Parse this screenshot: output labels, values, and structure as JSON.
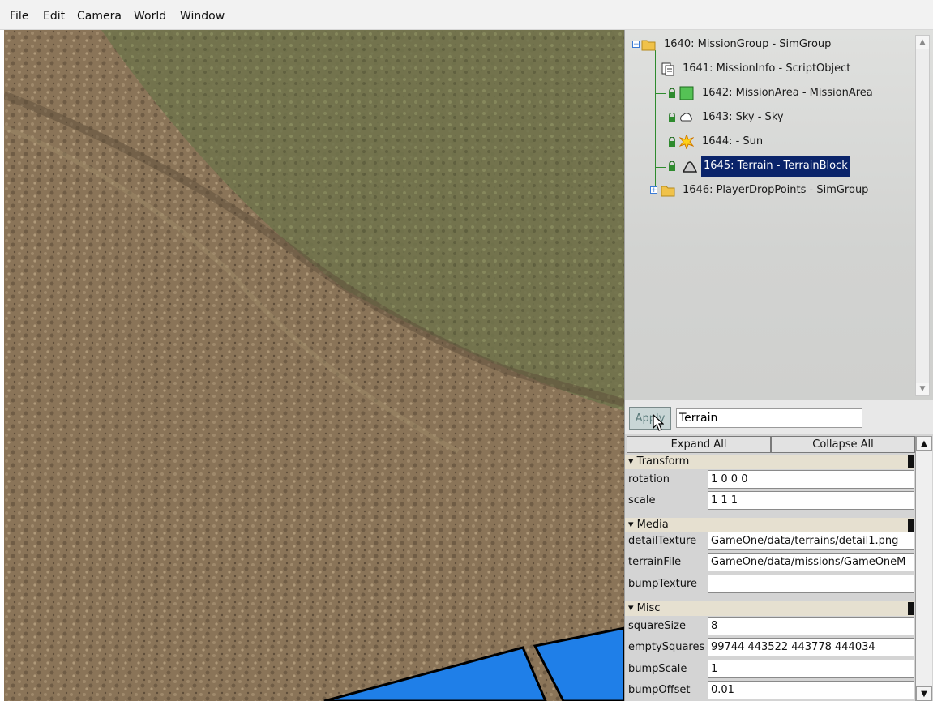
{
  "menu": [
    "File",
    "Edit",
    "Camera",
    "World",
    "Window"
  ],
  "tree": {
    "nodes": [
      {
        "label": "1640: MissionGroup - SimGroup",
        "icon": "folder-icon"
      },
      {
        "label": "1641: MissionInfo - ScriptObject",
        "icon": "script-object-icon"
      },
      {
        "label": "1642: MissionArea - MissionArea",
        "icon": "mission-area-icon"
      },
      {
        "label": "1643: Sky - Sky",
        "icon": "sky-icon"
      },
      {
        "label": "1644: - Sun",
        "icon": "sun-icon"
      },
      {
        "label": "1645: Terrain - TerrainBlock",
        "icon": "terrain-icon",
        "selected": true
      },
      {
        "label": "1646: PlayerDropPoints - SimGroup",
        "icon": "folder-icon"
      }
    ],
    "scroll_up": "▲",
    "scroll_down": "▼"
  },
  "apply": {
    "button": "Apply",
    "name_value": "Terrain"
  },
  "inspector": {
    "expand_all": "Expand All",
    "collapse_all": "Collapse All",
    "sections": [
      {
        "title": "Transform",
        "fields": [
          {
            "label": "rotation",
            "value": "1 0 0 0"
          },
          {
            "label": "scale",
            "value": "1 1 1"
          }
        ]
      },
      {
        "title": "Media",
        "fields": [
          {
            "label": "detailTexture",
            "value": "GameOne/data/terrains/detail1.png"
          },
          {
            "label": "terrainFile",
            "value": "GameOne/data/missions/GameOneM"
          },
          {
            "label": "bumpTexture",
            "value": ""
          }
        ]
      },
      {
        "title": "Misc",
        "fields": [
          {
            "label": "squareSize",
            "value": "8"
          },
          {
            "label": "emptySquares",
            "value": "99744 443522 443778 444034"
          },
          {
            "label": "bumpScale",
            "value": "1"
          },
          {
            "label": "bumpOffset",
            "value": "0.01"
          }
        ]
      }
    ],
    "section_marker": "▾",
    "scroll_up": "▲",
    "scroll_down": "▼"
  },
  "colors": {
    "selection": "#0a246a",
    "tree_line": "#2e8b2e",
    "viewport_blue": "#1f7fe8"
  }
}
